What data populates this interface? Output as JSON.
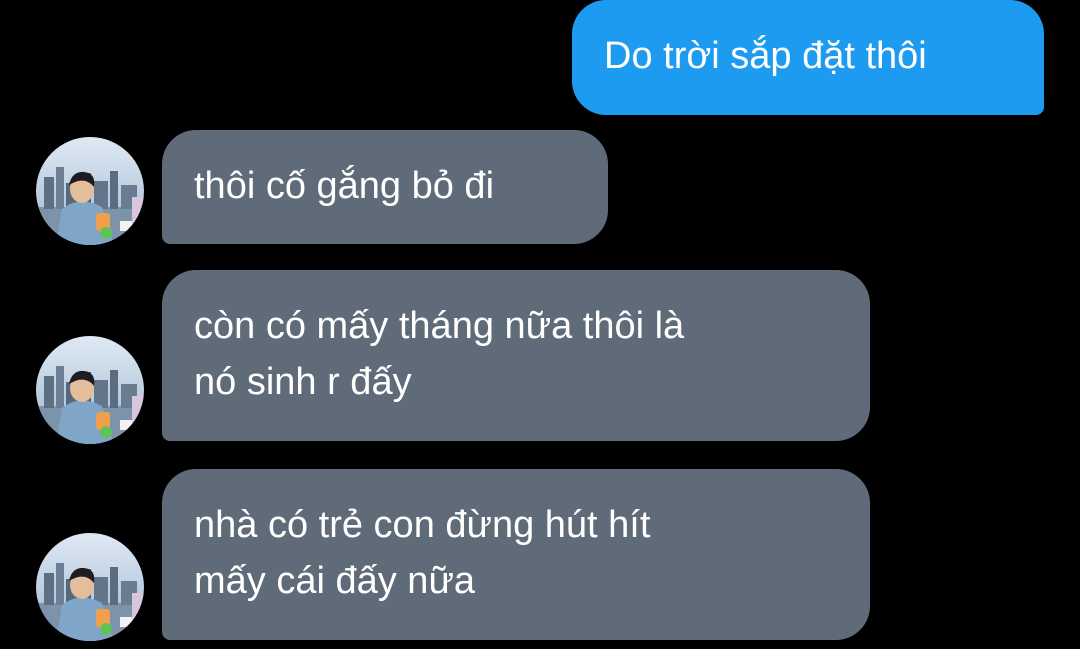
{
  "conversation": {
    "messages": [
      {
        "sender": "me",
        "text": "Do trời sắp đặt thôi"
      },
      {
        "sender": "contact",
        "text": "thôi cố gắng bỏ đi"
      },
      {
        "sender": "contact",
        "text": "còn có mấy tháng nữa thôi là\nnó sinh r đấy"
      },
      {
        "sender": "contact",
        "text": "nhà có trẻ con đừng hút hít\nmấy cái đấy nữa"
      }
    ]
  },
  "colors": {
    "background": "#000000",
    "outgoing_bubble": "#1d9bf0",
    "incoming_bubble": "#5f6b78",
    "text": "#ffffff"
  },
  "icons": {
    "contact_avatar": "contact-avatar-photo"
  }
}
